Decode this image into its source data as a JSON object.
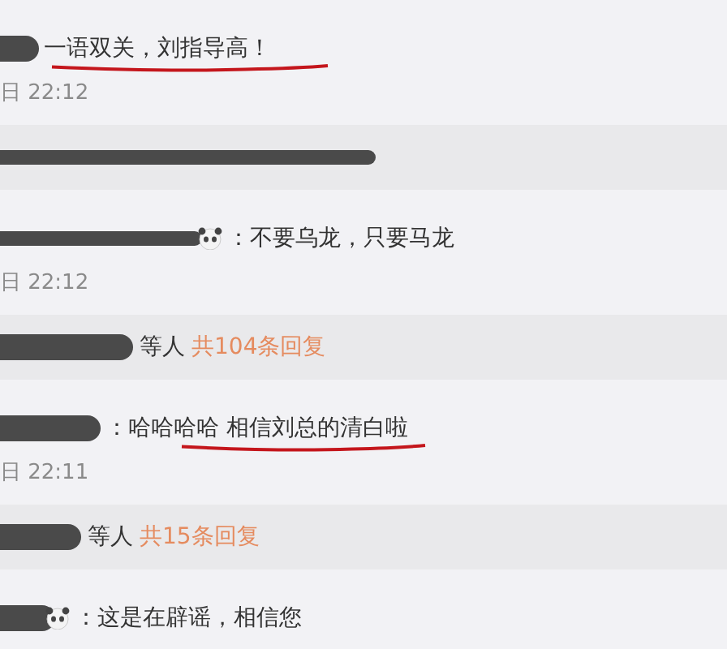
{
  "feed": [
    {
      "kind": "comment",
      "emoji": false,
      "text": "一语双关，刘指导高！",
      "time": "日 22:12",
      "underlined": true
    },
    {
      "kind": "replies"
    },
    {
      "kind": "comment",
      "emoji": true,
      "text": "：不要乌龙，只要马龙",
      "time": "日 22:12",
      "underlined": false
    },
    {
      "kind": "replies",
      "who": "等人",
      "count": "共104条回复"
    },
    {
      "kind": "comment",
      "emoji": false,
      "text": "：哈哈哈哈 相信刘总的清白啦",
      "time": "日 22:11",
      "underlined": true
    },
    {
      "kind": "replies",
      "who": "等人",
      "count": "共15条回复"
    },
    {
      "kind": "comment",
      "emoji": true,
      "text": "：这是在辟谣，相信您",
      "underlined": false
    }
  ]
}
